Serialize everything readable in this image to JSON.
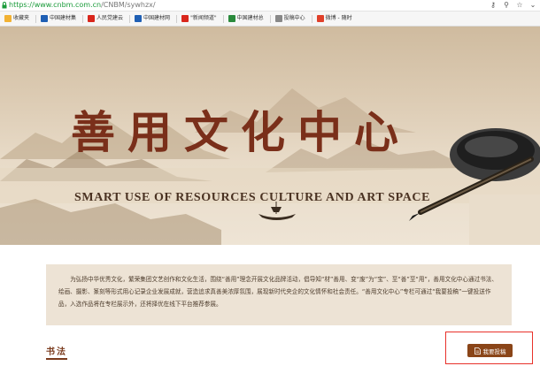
{
  "browser": {
    "url_scheme": "https://",
    "url_host": "www.cnbm.com.cn",
    "url_path": "/CNBM/sywhzx/",
    "icons": [
      "key-icon",
      "search-icon",
      "star-icon",
      "chevron-down-icon"
    ]
  },
  "bookmarks": [
    {
      "label": "收藏夹",
      "color": "#f2b233"
    },
    {
      "label": "中国建材集",
      "color": "#1f5fb4"
    },
    {
      "label": "人民党建云",
      "color": "#d9261c"
    },
    {
      "label": "中国建材网",
      "color": "#1f5fb4"
    },
    {
      "label": "\"新闻频道\"",
      "color": "#d9261c"
    },
    {
      "label": "中国建材总",
      "color": "#2a8a3c"
    },
    {
      "label": "投稿中心",
      "color": "#888888"
    },
    {
      "label": "微博 - 随时",
      "color": "#e0402a"
    }
  ],
  "banner": {
    "title": "善用文化中心",
    "subtitle": "SMART USE OF RESOURCES CULTURE AND ART SPACE"
  },
  "intro": {
    "text": "为弘扬中华优秀文化，繁荣集团文艺创作和文化生活，围绕“善用”理念开展文化品牌活动，倡导知“材”善用、变“废”为“宝”、至“善”至“用”，善用文化中心通过书法、绘画、摄影、篆刻等形式用心记录企业发展成就，营造追求真善美浓厚氛围，展现新时代央企的文化情怀和社会责任。“善用文化中心”专栏可通过“我要投稿”一键投送作品，入选作品将在专栏展示外，还将择优在线下平台推荐参展。"
  },
  "section": {
    "title": "书法",
    "submit_label": "我要投稿"
  },
  "colors": {
    "brand": "#7a2f1a",
    "button": "#8a4518",
    "highlight": "#e8312a",
    "url": "#1a9b3a"
  }
}
